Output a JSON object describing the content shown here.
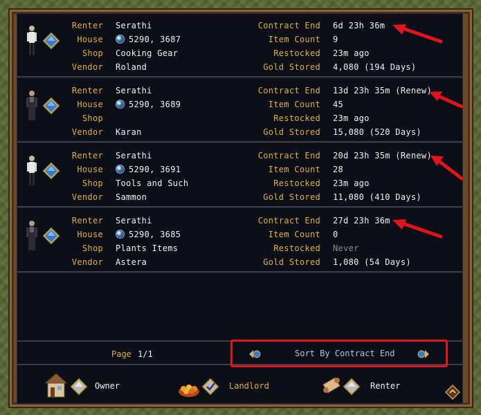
{
  "labels": {
    "renter": "Renter",
    "house": "House",
    "shop": "Shop",
    "vendor": "Vendor",
    "contract_end": "Contract End",
    "item_count": "Item Count",
    "restocked": "Restocked",
    "gold_stored": "Gold Stored"
  },
  "rows": [
    {
      "renter": "Serathi",
      "house": "5290, 3687",
      "shop": "Cooking Gear",
      "vendor": "Roland",
      "contract_end": "6d 23h 36m",
      "item_count": "9",
      "restocked": "23m ago",
      "gold_stored": "4,080  (194 Days)"
    },
    {
      "renter": "Serathi",
      "house": "5290, 3689",
      "shop": "",
      "vendor": "Karan",
      "contract_end": "13d 23h 35m (Renew)",
      "item_count": "45",
      "restocked": "23m ago",
      "gold_stored": "15,080  (520 Days)"
    },
    {
      "renter": "Serathi",
      "house": "5290, 3691",
      "shop": "Tools and Such",
      "vendor": "Sammon",
      "contract_end": "20d 23h 35m (Renew)",
      "item_count": "28",
      "restocked": "23m ago",
      "gold_stored": "11,080  (410 Days)"
    },
    {
      "renter": "Serathi",
      "house": "5290, 3685",
      "shop": "Plants Items",
      "vendor": "Astera",
      "contract_end": "27d 23h 36m",
      "item_count": "0",
      "restocked": "Never",
      "gold_stored": "1,080  (54 Days)"
    }
  ],
  "footer": {
    "page_label": "Page",
    "page_value": "1/1",
    "sort_label": "Sort By Contract End"
  },
  "buttons": {
    "owner": "Owner",
    "landlord": "Landlord",
    "renter": "Renter"
  },
  "colors": {
    "label_gold": "#e0b040",
    "value_white": "#f2f2f2",
    "panel_bg": "#0c0e18",
    "highlight_red": "#e0141c",
    "sort_text": "#a9c6e8"
  }
}
